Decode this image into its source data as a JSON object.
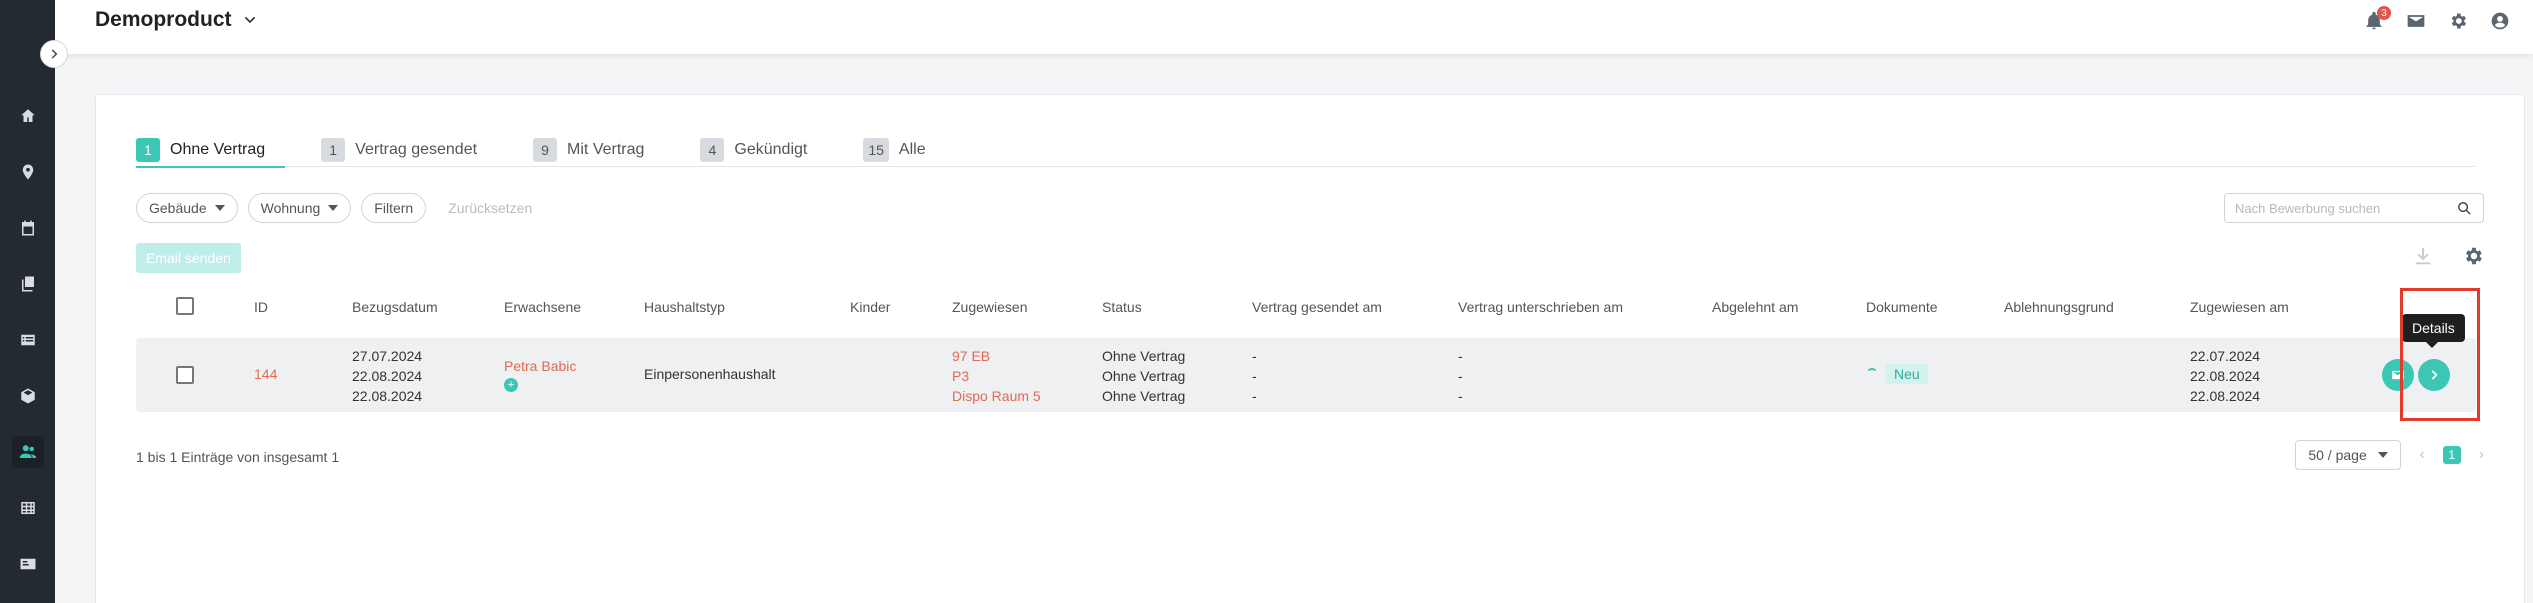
{
  "app": {
    "title": "Demoproduct",
    "notification_count": "3"
  },
  "tabs": [
    {
      "count": "1",
      "label": "Ohne Vertrag"
    },
    {
      "count": "1",
      "label": "Vertrag gesendet"
    },
    {
      "count": "9",
      "label": "Mit Vertrag"
    },
    {
      "count": "4",
      "label": "Gekündigt"
    },
    {
      "count": "15",
      "label": "Alle"
    }
  ],
  "filters": {
    "building": "Gebäude",
    "apartment": "Wohnung",
    "filter": "Filtern",
    "reset": "Zurücksetzen",
    "search_placeholder": "Nach Bewerbung suchen"
  },
  "actions": {
    "email": "Email senden"
  },
  "columns": {
    "id": "ID",
    "move_in": "Bezugsdatum",
    "adults": "Erwachsene",
    "household": "Haushaltstyp",
    "children": "Kinder",
    "assigned": "Zugewiesen",
    "status": "Status",
    "contract_sent": "Vertrag gesendet am",
    "contract_signed": "Vertrag unterschrieben am",
    "rejected": "Abgelehnt am",
    "documents": "Dokumente",
    "rejection_reason": "Ablehnungsgrund",
    "assigned_at": "Zugewiesen am"
  },
  "row": {
    "id": "144",
    "move_in": [
      "27.07.2024",
      "22.08.2024",
      "22.08.2024"
    ],
    "adult": "Petra Babic",
    "household": "Einpersonenhaushalt",
    "assigned": [
      "97 EB",
      "P3",
      "Dispo Raum 5"
    ],
    "status": [
      "Ohne Vertrag",
      "Ohne Vertrag",
      "Ohne Vertrag"
    ],
    "contract_sent": [
      "-",
      "-",
      "-"
    ],
    "contract_signed": [
      "-",
      "-",
      "-"
    ],
    "document_badge": "Neu",
    "assigned_at": [
      "22.07.2024",
      "22.08.2024",
      "22.08.2024"
    ]
  },
  "tooltip": "Details",
  "footer": {
    "info": "1 bis 1 Einträge von insgesamt 1",
    "page_size": "50 / page",
    "current_page": "1"
  },
  "colors": {
    "accent": "#3cc7b4",
    "link": "#e06a52",
    "highlight": "#e23b2e"
  }
}
